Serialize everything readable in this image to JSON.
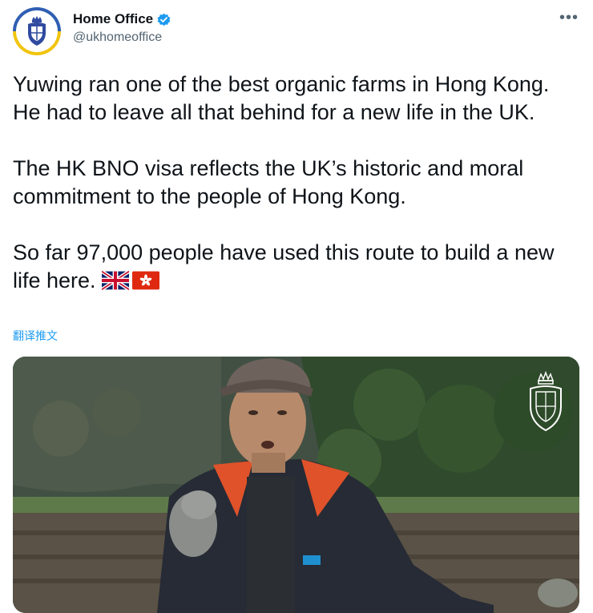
{
  "account": {
    "name": "Home Office",
    "handle": "@ukhomeoffice",
    "verified": true,
    "avatar_colors": [
      "#2f5fb3",
      "#f1c40f"
    ]
  },
  "menu_icon": "more-options-icon",
  "tweet": {
    "text": "Yuwing ran one of the best organic farms in Hong Kong. He had to leave all that behind for a new life in the UK.\n\nThe HK BNO visa reflects the UK’s historic and moral commitment to the people of Hong Kong.\n\nSo far 97,000 people have used this route to build a new life here. ",
    "flags": [
      "uk-flag-icon",
      "hong-kong-flag-icon"
    ]
  },
  "translate_label": "翻译推文",
  "media": {
    "type": "video-still",
    "watermark": "royal-crest-icon"
  },
  "colors": {
    "link": "#1d9bf0",
    "verified": "#1d9bf0",
    "secondary_text": "#536471"
  }
}
